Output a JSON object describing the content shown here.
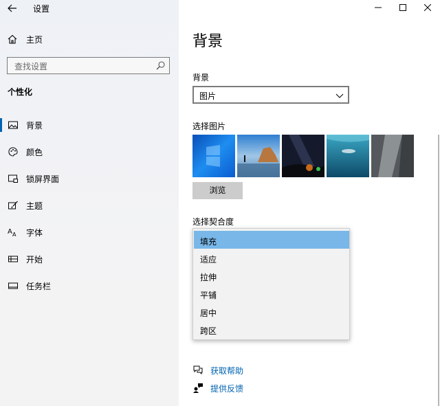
{
  "window": {
    "title": "设置",
    "controls": [
      "minimize",
      "maximize",
      "close"
    ]
  },
  "sidebar": {
    "home_label": "主页",
    "search_placeholder": "查找设置",
    "section_title": "个性化",
    "items": [
      {
        "label": "背景",
        "icon": "picture-icon",
        "active": true
      },
      {
        "label": "颜色",
        "icon": "palette-icon",
        "active": false
      },
      {
        "label": "锁屏界面",
        "icon": "lockscreen-icon",
        "active": false
      },
      {
        "label": "主题",
        "icon": "brush-icon",
        "active": false
      },
      {
        "label": "字体",
        "icon": "font-icon",
        "active": false
      },
      {
        "label": "开始",
        "icon": "start-icon",
        "active": false
      },
      {
        "label": "任务栏",
        "icon": "taskbar-icon",
        "active": false
      }
    ]
  },
  "main": {
    "title": "背景",
    "background_label": "背景",
    "background_value": "图片",
    "choose_picture_label": "选择图片",
    "thumbnails": [
      "windows-blue",
      "beach-rocks",
      "night-sky",
      "underwater-swimmer",
      "rock-cliff"
    ],
    "browse_label": "浏览",
    "fit_label": "选择契合度",
    "fit_options": [
      "填充",
      "适应",
      "拉伸",
      "平铺",
      "居中",
      "跨区"
    ],
    "fit_selected": "填充",
    "links": [
      {
        "label": "获取帮助",
        "icon": "help-chat-icon"
      },
      {
        "label": "提供反馈",
        "icon": "feedback-icon"
      }
    ]
  },
  "colors": {
    "accent": "#0063b1",
    "selected_option": "#78b7e8",
    "button_bg": "#cccccc"
  }
}
